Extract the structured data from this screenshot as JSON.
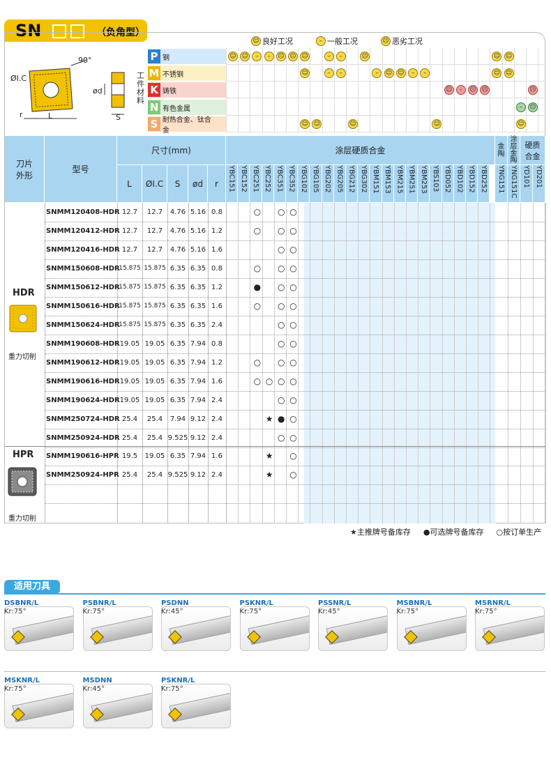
{
  "header": {
    "series": "SN",
    "type": "（负角型）"
  },
  "legend": [
    {
      "icon": "smile-icon",
      "label": "良好工况"
    },
    {
      "icon": "neutral-icon",
      "label": "一般工况"
    },
    {
      "icon": "sad-icon",
      "label": "恶劣工况"
    }
  ],
  "diagram": {
    "dim_ic": "ØI.C",
    "angle": "90°",
    "dim_r": "r",
    "dim_L": "L",
    "dim_d": "ød",
    "dim_S": "S"
  },
  "workpiece_label": "工件材料",
  "materials": [
    {
      "letter": "P",
      "name": "钢",
      "color": "#2a7fd0",
      "band": "#d4e9fa"
    },
    {
      "letter": "M",
      "name": "不锈钢",
      "color": "#f0b400",
      "band": "#fdf1c4"
    },
    {
      "letter": "K",
      "name": "铸铁",
      "color": "#e0302a",
      "band": "#f9d3cd"
    },
    {
      "letter": "N",
      "name": "有色金属",
      "color": "#7fc97a",
      "band": "#dff0dc"
    },
    {
      "letter": "S",
      "name": "耐热合金、钛合金",
      "color": "#f6a86a",
      "band": "#fde1c9"
    }
  ],
  "table": {
    "col_shape": "刀片外形",
    "col_model": "型号",
    "col_dim": "尺寸(mm)",
    "col_coated": "涂层硬质合金",
    "col_cermet": "金陶",
    "col_coated_cermet": "涂层金陶",
    "col_carbide": "硬质合金",
    "dim_cols": [
      "L",
      "ØI.C",
      "S",
      "ød",
      "r"
    ],
    "grades": [
      "YBC151",
      "YBC152",
      "YBC251",
      "YBC252",
      "YBC351",
      "YBC352",
      "YBG102",
      "YBG105",
      "YBG202",
      "YBG205",
      "YBG212",
      "YBG302",
      "YBM151",
      "YBM153",
      "YBM215",
      "YBM251",
      "YBM253",
      "YBS103",
      "YBD052",
      "YBD102",
      "YBD152",
      "YBD252",
      "YNG151",
      "YNG151C",
      "YD101",
      "YD201"
    ],
    "groups": [
      {
        "name": "HDR",
        "desc": "重力切削"
      },
      {
        "name": "HPR",
        "desc": "重力切削"
      }
    ],
    "rows": [
      {
        "model": "SNMM120408-HDR",
        "L": "12.7",
        "IC": "12.7",
        "S": "4.76",
        "d": "5.16",
        "r": "0.8"
      },
      {
        "model": "SNMM120412-HDR",
        "L": "12.7",
        "IC": "12.7",
        "S": "4.76",
        "d": "5.16",
        "r": "1.2"
      },
      {
        "model": "SNMM120416-HDR",
        "L": "12.7",
        "IC": "12.7",
        "S": "4.76",
        "d": "5.16",
        "r": "1.6"
      },
      {
        "model": "SNMM150608-HDR",
        "L": "15.875",
        "IC": "15.875",
        "S": "6.35",
        "d": "6.35",
        "r": "0.8"
      },
      {
        "model": "SNMM150612-HDR",
        "L": "15.875",
        "IC": "15.875",
        "S": "6.35",
        "d": "6.35",
        "r": "1.2"
      },
      {
        "model": "SNMM150616-HDR",
        "L": "15.875",
        "IC": "15.875",
        "S": "6.35",
        "d": "6.35",
        "r": "1.6"
      },
      {
        "model": "SNMM150624-HDR",
        "L": "15.875",
        "IC": "15.875",
        "S": "6.35",
        "d": "6.35",
        "r": "2.4"
      },
      {
        "model": "SNMM190608-HDR",
        "L": "19.05",
        "IC": "19.05",
        "S": "6.35",
        "d": "7.94",
        "r": "0.8"
      },
      {
        "model": "SNMM190612-HDR",
        "L": "19.05",
        "IC": "19.05",
        "S": "6.35",
        "d": "7.94",
        "r": "1.2"
      },
      {
        "model": "SNMM190616-HDR",
        "L": "19.05",
        "IC": "19.05",
        "S": "6.35",
        "d": "7.94",
        "r": "1.6"
      },
      {
        "model": "SNMM190624-HDR",
        "L": "19.05",
        "IC": "19.05",
        "S": "6.35",
        "d": "7.94",
        "r": "2.4"
      },
      {
        "model": "SNMM250724-HDR",
        "L": "25.4",
        "IC": "25.4",
        "S": "7.94",
        "d": "9.12",
        "r": "2.4"
      },
      {
        "model": "SNMM250924-HDR",
        "L": "25.4",
        "IC": "25.4",
        "S": "9.525",
        "d": "9.12",
        "r": "2.4"
      },
      {
        "model": "SNMM190616-HPR",
        "L": "19.5",
        "IC": "19.05",
        "S": "6.35",
        "d": "7.94",
        "r": "1.6"
      },
      {
        "model": "SNMM250924-HPR",
        "L": "25.4",
        "IC": "25.4",
        "S": "9.525",
        "d": "9.12",
        "r": "2.4"
      }
    ],
    "marks": [
      {
        "row": 0,
        "col": 2,
        "s": "○"
      },
      {
        "row": 0,
        "col": 4,
        "s": "○"
      },
      {
        "row": 0,
        "col": 5,
        "s": "○"
      },
      {
        "row": 1,
        "col": 2,
        "s": "○"
      },
      {
        "row": 1,
        "col": 4,
        "s": "○"
      },
      {
        "row": 1,
        "col": 5,
        "s": "○"
      },
      {
        "row": 2,
        "col": 4,
        "s": "○"
      },
      {
        "row": 2,
        "col": 5,
        "s": "○"
      },
      {
        "row": 3,
        "col": 2,
        "s": "○"
      },
      {
        "row": 3,
        "col": 4,
        "s": "○"
      },
      {
        "row": 3,
        "col": 5,
        "s": "○"
      },
      {
        "row": 4,
        "col": 2,
        "s": "●"
      },
      {
        "row": 4,
        "col": 4,
        "s": "○"
      },
      {
        "row": 4,
        "col": 5,
        "s": "○"
      },
      {
        "row": 5,
        "col": 2,
        "s": "○"
      },
      {
        "row": 5,
        "col": 4,
        "s": "○"
      },
      {
        "row": 5,
        "col": 5,
        "s": "○"
      },
      {
        "row": 6,
        "col": 4,
        "s": "○"
      },
      {
        "row": 6,
        "col": 5,
        "s": "○"
      },
      {
        "row": 7,
        "col": 4,
        "s": "○"
      },
      {
        "row": 7,
        "col": 5,
        "s": "○"
      },
      {
        "row": 8,
        "col": 2,
        "s": "○"
      },
      {
        "row": 8,
        "col": 4,
        "s": "○"
      },
      {
        "row": 8,
        "col": 5,
        "s": "○"
      },
      {
        "row": 9,
        "col": 2,
        "s": "○"
      },
      {
        "row": 9,
        "col": 3,
        "s": "○"
      },
      {
        "row": 9,
        "col": 4,
        "s": "○"
      },
      {
        "row": 9,
        "col": 5,
        "s": "○"
      },
      {
        "row": 10,
        "col": 4,
        "s": "○"
      },
      {
        "row": 10,
        "col": 5,
        "s": "○"
      },
      {
        "row": 11,
        "col": 3,
        "s": "★"
      },
      {
        "row": 11,
        "col": 4,
        "s": "●"
      },
      {
        "row": 11,
        "col": 5,
        "s": "○"
      },
      {
        "row": 12,
        "col": 4,
        "s": "○"
      },
      {
        "row": 12,
        "col": 5,
        "s": "○"
      },
      {
        "row": 13,
        "col": 3,
        "s": "★"
      },
      {
        "row": 13,
        "col": 5,
        "s": "○"
      },
      {
        "row": 14,
        "col": 3,
        "s": "★"
      },
      {
        "row": 14,
        "col": 5,
        "s": "○"
      }
    ],
    "condition_marks": [
      {
        "mat": 0,
        "col": 0,
        "t": "g"
      },
      {
        "mat": 0,
        "col": 1,
        "t": "g"
      },
      {
        "mat": 0,
        "col": 2,
        "t": "n"
      },
      {
        "mat": 0,
        "col": 3,
        "t": "n"
      },
      {
        "mat": 0,
        "col": 4,
        "t": "s"
      },
      {
        "mat": 0,
        "col": 5,
        "t": "s"
      },
      {
        "mat": 0,
        "col": 6,
        "t": "g"
      },
      {
        "mat": 0,
        "col": 8,
        "t": "n"
      },
      {
        "mat": 0,
        "col": 9,
        "t": "n"
      },
      {
        "mat": 0,
        "col": 11,
        "t": "s"
      },
      {
        "mat": 0,
        "col": 22,
        "t": "g"
      },
      {
        "mat": 0,
        "col": 23,
        "t": "g"
      },
      {
        "mat": 1,
        "col": 6,
        "t": "g"
      },
      {
        "mat": 1,
        "col": 8,
        "t": "n"
      },
      {
        "mat": 1,
        "col": 9,
        "t": "n"
      },
      {
        "mat": 1,
        "col": 12,
        "t": "n"
      },
      {
        "mat": 1,
        "col": 13,
        "t": "g"
      },
      {
        "mat": 1,
        "col": 14,
        "t": "g"
      },
      {
        "mat": 1,
        "col": 15,
        "t": "n"
      },
      {
        "mat": 1,
        "col": 16,
        "t": "n"
      },
      {
        "mat": 1,
        "col": 22,
        "t": "g"
      },
      {
        "mat": 1,
        "col": 23,
        "t": "g"
      },
      {
        "mat": 2,
        "col": 18,
        "t": "g"
      },
      {
        "mat": 2,
        "col": 19,
        "t": "n"
      },
      {
        "mat": 2,
        "col": 20,
        "t": "s"
      },
      {
        "mat": 2,
        "col": 21,
        "t": "s"
      },
      {
        "mat": 2,
        "col": 25,
        "t": "s"
      },
      {
        "mat": 3,
        "col": 24,
        "t": "n"
      },
      {
        "mat": 3,
        "col": 25,
        "t": "s"
      },
      {
        "mat": 4,
        "col": 6,
        "t": "g"
      },
      {
        "mat": 4,
        "col": 7,
        "t": "g"
      },
      {
        "mat": 4,
        "col": 10,
        "t": "g"
      },
      {
        "mat": 4,
        "col": 17,
        "t": "g"
      },
      {
        "mat": 4,
        "col": 24,
        "t": "g"
      }
    ]
  },
  "footnote": {
    "star": "★主推牌号备库存",
    "dot": "●可选牌号备库存",
    "circle": "○按订单生产"
  },
  "tools": {
    "heading": "适用刀具",
    "items": [
      {
        "name": "DSBNR/L",
        "kr": "Kr:75°"
      },
      {
        "name": "PSBNR/L",
        "kr": "Kr:75°"
      },
      {
        "name": "PSDNN",
        "kr": "Kr:45°"
      },
      {
        "name": "PSKNR/L",
        "kr": "Kr:75°"
      },
      {
        "name": "PSSNR/L",
        "kr": "Kr:45°"
      },
      {
        "name": "MSBNR/L",
        "kr": "Kr:75°"
      },
      {
        "name": "MSRNR/L",
        "kr": "Kr:75°"
      },
      {
        "name": "MSKNR/L",
        "kr": "Kr:75°"
      },
      {
        "name": "MSDNN",
        "kr": "Kr:45°"
      },
      {
        "name": "PSKNR/L",
        "kr": "Kr:75°"
      }
    ]
  }
}
